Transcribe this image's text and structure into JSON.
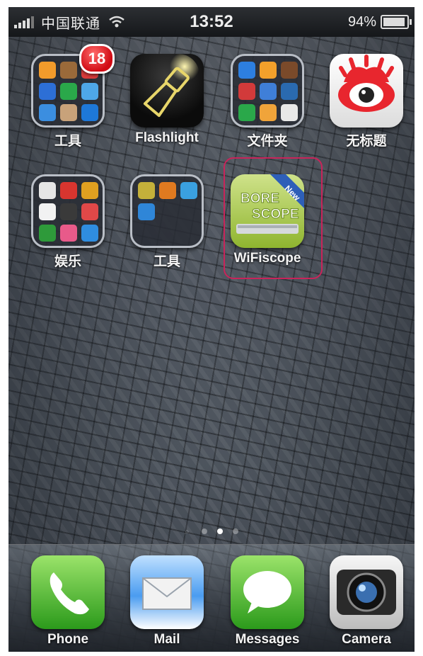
{
  "status_bar": {
    "carrier": "中国联通",
    "time": "13:52",
    "battery": "94%"
  },
  "home_screen": {
    "row1": [
      {
        "label": "工具",
        "badge": "18",
        "kind": "folder"
      },
      {
        "label": "Flashlight",
        "kind": "app"
      },
      {
        "label": "文件夹",
        "kind": "folder"
      },
      {
        "label": "无标题",
        "kind": "app"
      }
    ],
    "row2": [
      {
        "label": "娱乐",
        "kind": "folder"
      },
      {
        "label": "工具",
        "kind": "folder"
      },
      {
        "label": "WiFiscope",
        "kind": "app",
        "ribbon": "New",
        "icon_text": "BORE SCOPE"
      }
    ],
    "page_count": 4,
    "active_page": 3
  },
  "dock": {
    "items": [
      {
        "label": "Phone"
      },
      {
        "label": "Mail"
      },
      {
        "label": "Messages"
      },
      {
        "label": "Camera"
      }
    ]
  },
  "colors": {
    "highlight": "#c8245a",
    "badge": "#d10b14"
  }
}
